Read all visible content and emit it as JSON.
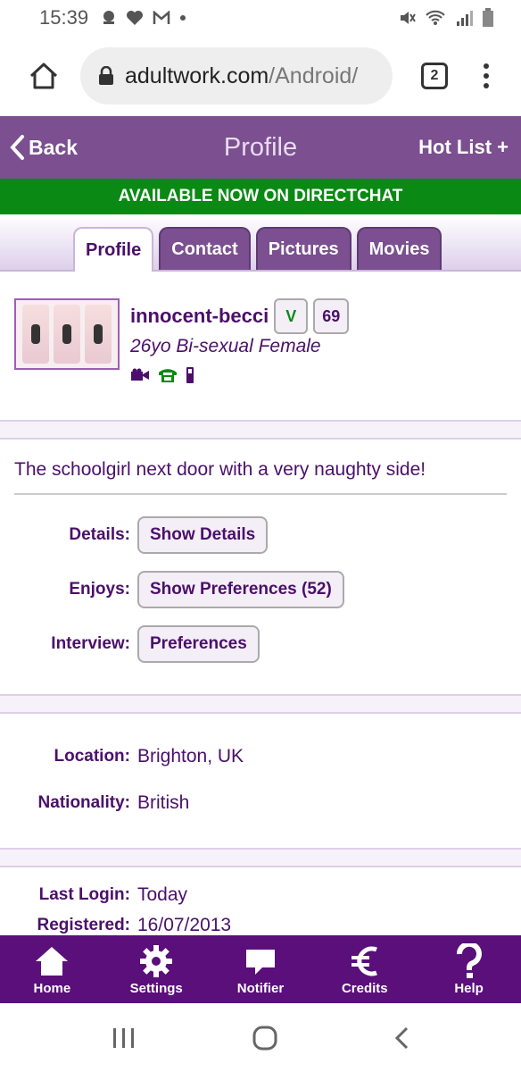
{
  "status_bar": {
    "time": "15:39"
  },
  "browser": {
    "url_domain": "adultwork.com",
    "url_path": "/Android/",
    "tab_count": "2"
  },
  "header": {
    "back_label": "Back",
    "title": "Profile",
    "hotlist_label": "Hot List +"
  },
  "banner": {
    "text": "AVAILABLE NOW ON DIRECTCHAT"
  },
  "tabs": [
    {
      "label": "Profile",
      "active": true
    },
    {
      "label": "Contact",
      "active": false
    },
    {
      "label": "Pictures",
      "active": false
    },
    {
      "label": "Movies",
      "active": false
    }
  ],
  "profile": {
    "username": "innocent-becci",
    "verified_badge": "V",
    "rating_badge": "69",
    "description": "26yo Bi-sexual Female",
    "contact_icons": [
      "webcam-icon",
      "phone-icon",
      "mobile-icon"
    ]
  },
  "tagline": "The schoolgirl next door with a very naughty side!",
  "details": [
    {
      "label": "Details:",
      "button": "Show Details"
    },
    {
      "label": "Enjoys:",
      "button": "Show Preferences (52)"
    },
    {
      "label": "Interview:",
      "button": "Preferences"
    }
  ],
  "location": {
    "label": "Location:",
    "value": "Brighton, UK"
  },
  "nationality": {
    "label": "Nationality:",
    "value": "British"
  },
  "last_login": {
    "label": "Last Login:",
    "value": "Today"
  },
  "registered": {
    "label": "Registered:",
    "value": "16/07/2013"
  },
  "bottom_nav": [
    {
      "label": "Home",
      "icon": "home-icon"
    },
    {
      "label": "Settings",
      "icon": "gear-icon"
    },
    {
      "label": "Notifier",
      "icon": "chat-bubble-icon"
    },
    {
      "label": "Credits",
      "icon": "euro-icon"
    },
    {
      "label": "Help",
      "icon": "question-icon"
    }
  ],
  "colors": {
    "header": "#7b4f90",
    "banner": "#0a8a14",
    "nav": "#5a0f7a",
    "text": "#4b0f6b"
  }
}
